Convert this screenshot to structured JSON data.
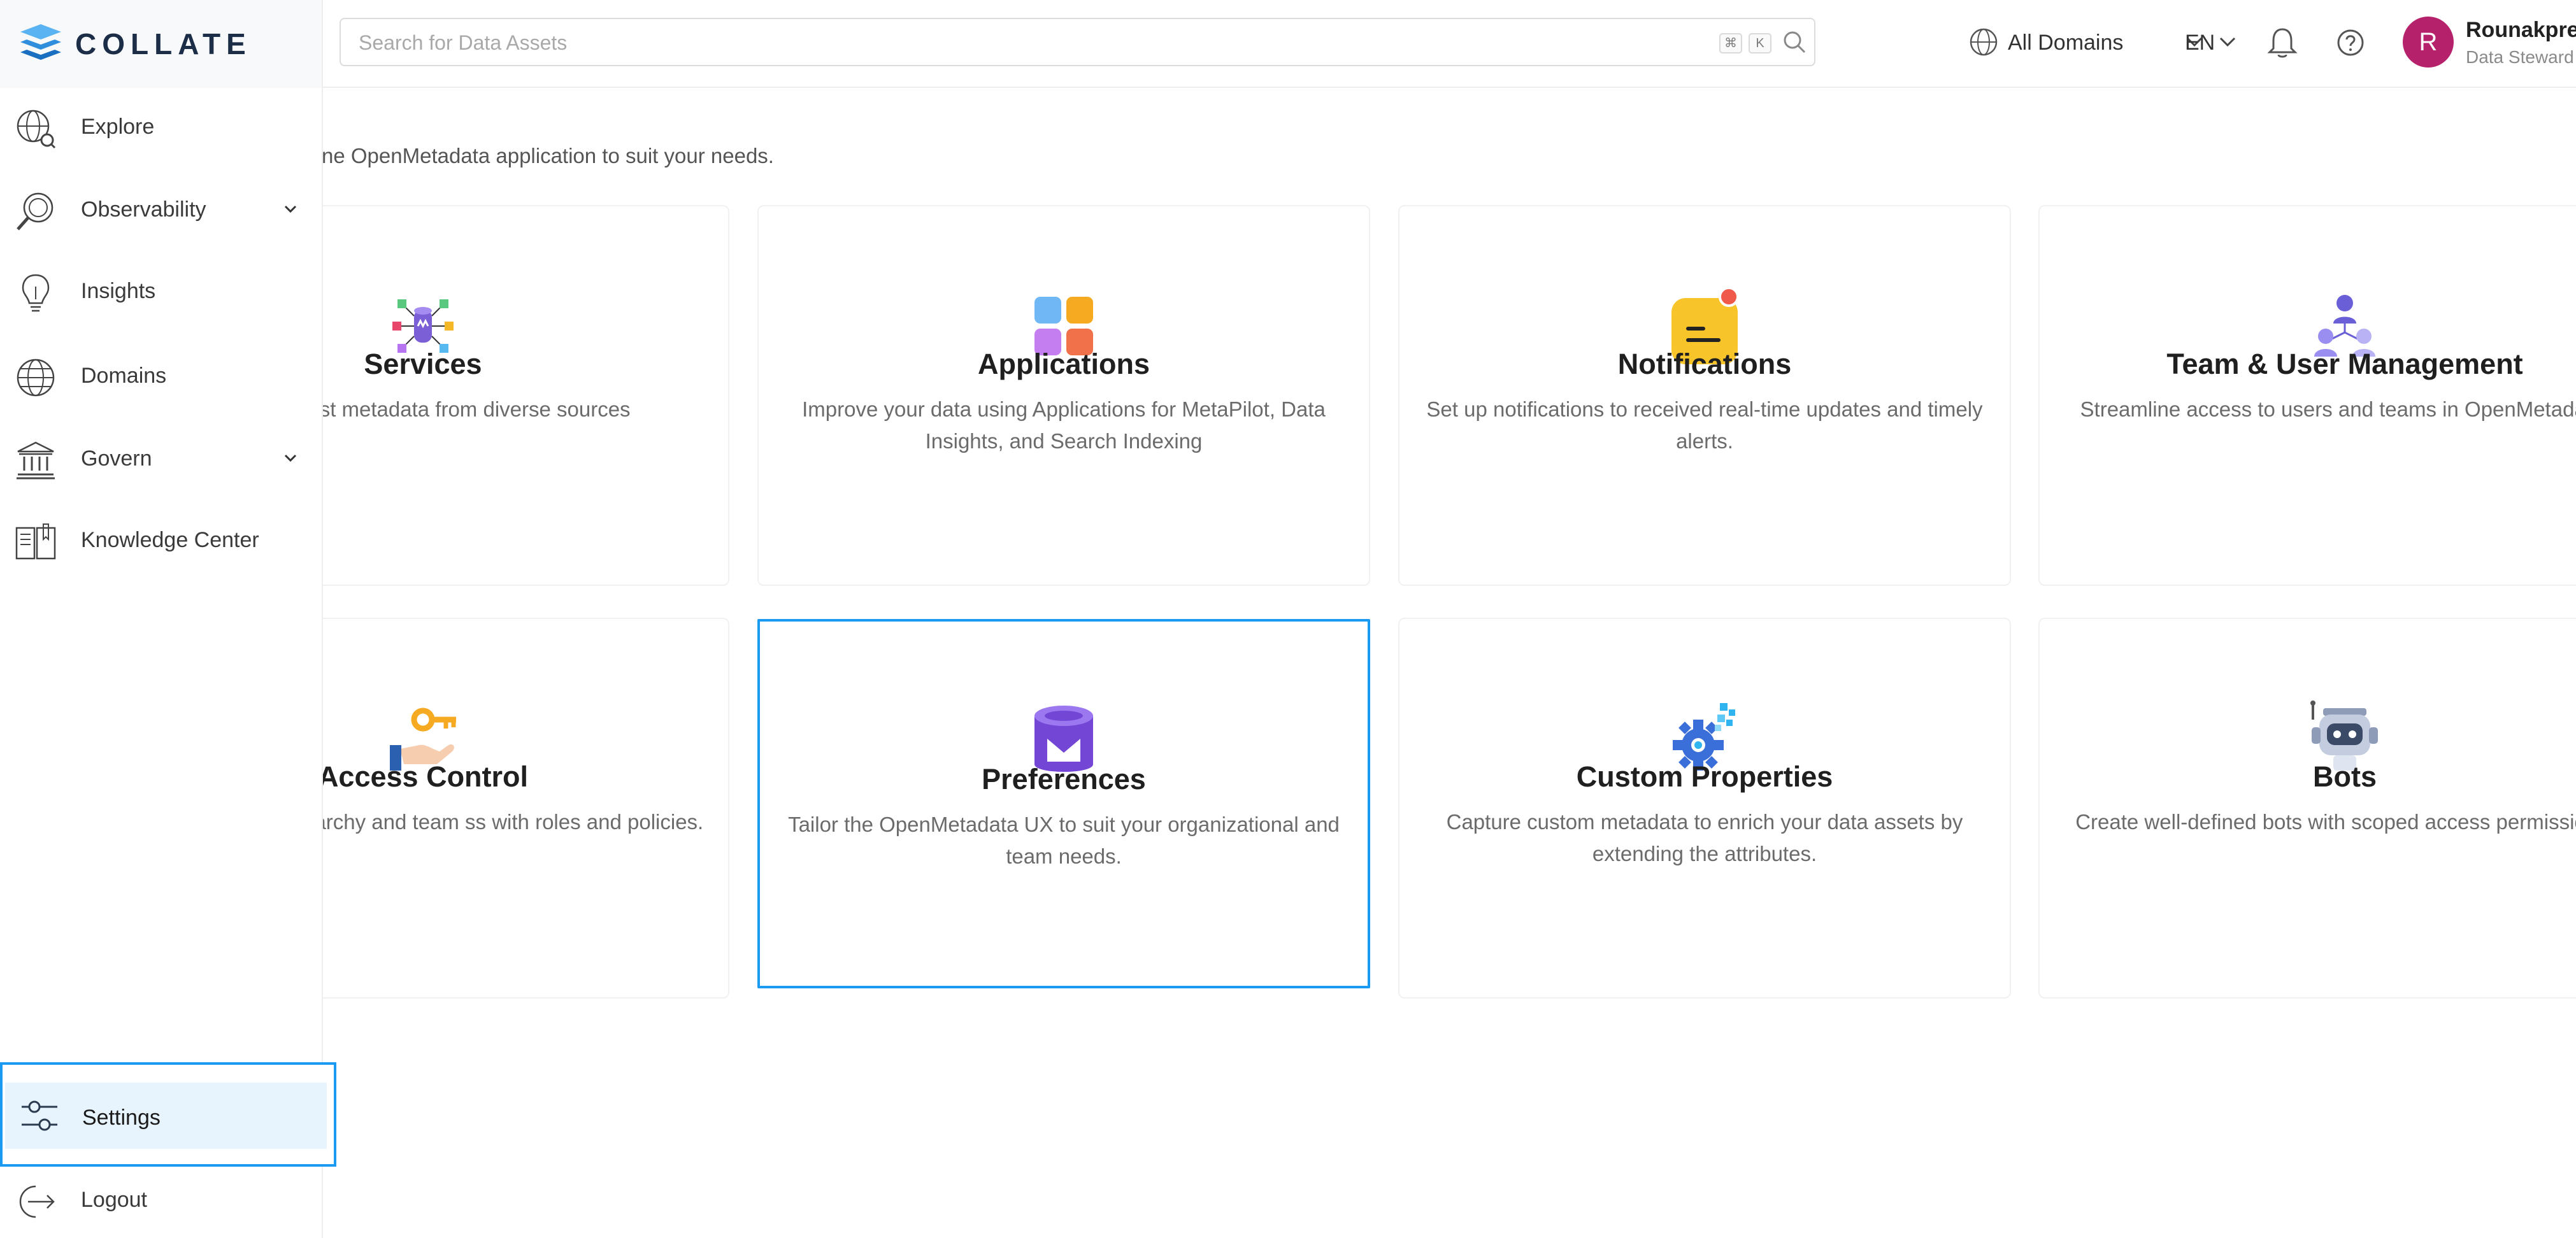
{
  "brand": {
    "name": "COLLATE"
  },
  "sidebar": {
    "items": [
      {
        "label": "Explore",
        "icon": "explore-icon"
      },
      {
        "label": "Observability",
        "icon": "observability-icon",
        "expandable": true
      },
      {
        "label": "Insights",
        "icon": "insights-icon"
      },
      {
        "label": "Domains",
        "icon": "domains-icon"
      },
      {
        "label": "Govern",
        "icon": "govern-icon",
        "expandable": true
      },
      {
        "label": "Knowledge Center",
        "icon": "knowledge-center-icon"
      }
    ],
    "settings": {
      "label": "Settings",
      "icon": "settings-icon",
      "selected": true
    },
    "logout": {
      "label": "Logout",
      "icon": "logout-icon"
    }
  },
  "header": {
    "search": {
      "placeholder": "Search for Data Assets",
      "value": "",
      "shortcut": [
        "⌘",
        "K"
      ]
    },
    "domain": {
      "label": "All Domains"
    },
    "language": {
      "label": "EN"
    },
    "user": {
      "initial": "R",
      "name": "Rounakpre",
      "role": "Data Steward"
    }
  },
  "main": {
    "subtitle": "ne OpenMetadata application to suit your needs.",
    "cards": [
      {
        "title": "Services",
        "desc": "rs and ingest metadata from diverse sources",
        "icon": "services-icon"
      },
      {
        "title": "Applications",
        "desc": "Improve your data using Applications for MetaPilot, Data Insights, and Search Indexing",
        "icon": "applications-icon"
      },
      {
        "title": "Notifications",
        "desc": "Set up notifications to received real-time updates and timely alerts.",
        "icon": "notifications-icon"
      },
      {
        "title": "Team & User Management",
        "desc": "Streamline access to users and teams in OpenMetadata.",
        "icon": "team-user-management-icon"
      },
      {
        "title": "Access Control",
        "desc": " organizational hierarchy and team ss with roles and policies.",
        "icon": "access-control-icon"
      },
      {
        "title": "Preferences",
        "desc": "Tailor the OpenMetadata UX to suit your organizational and team needs.",
        "icon": "preferences-icon",
        "selected": true
      },
      {
        "title": "Custom Properties",
        "desc": "Capture custom metadata to enrich your data assets by extending the attributes.",
        "icon": "custom-properties-icon"
      },
      {
        "title": "Bots",
        "desc": "Create well-defined bots with scoped access permissions.",
        "icon": "bots-icon"
      }
    ]
  },
  "colors": {
    "accent": "#1a9af0",
    "selectedBg": "#e8f4fd",
    "avatar": "#b5216b",
    "brand": "#1b2d47"
  }
}
